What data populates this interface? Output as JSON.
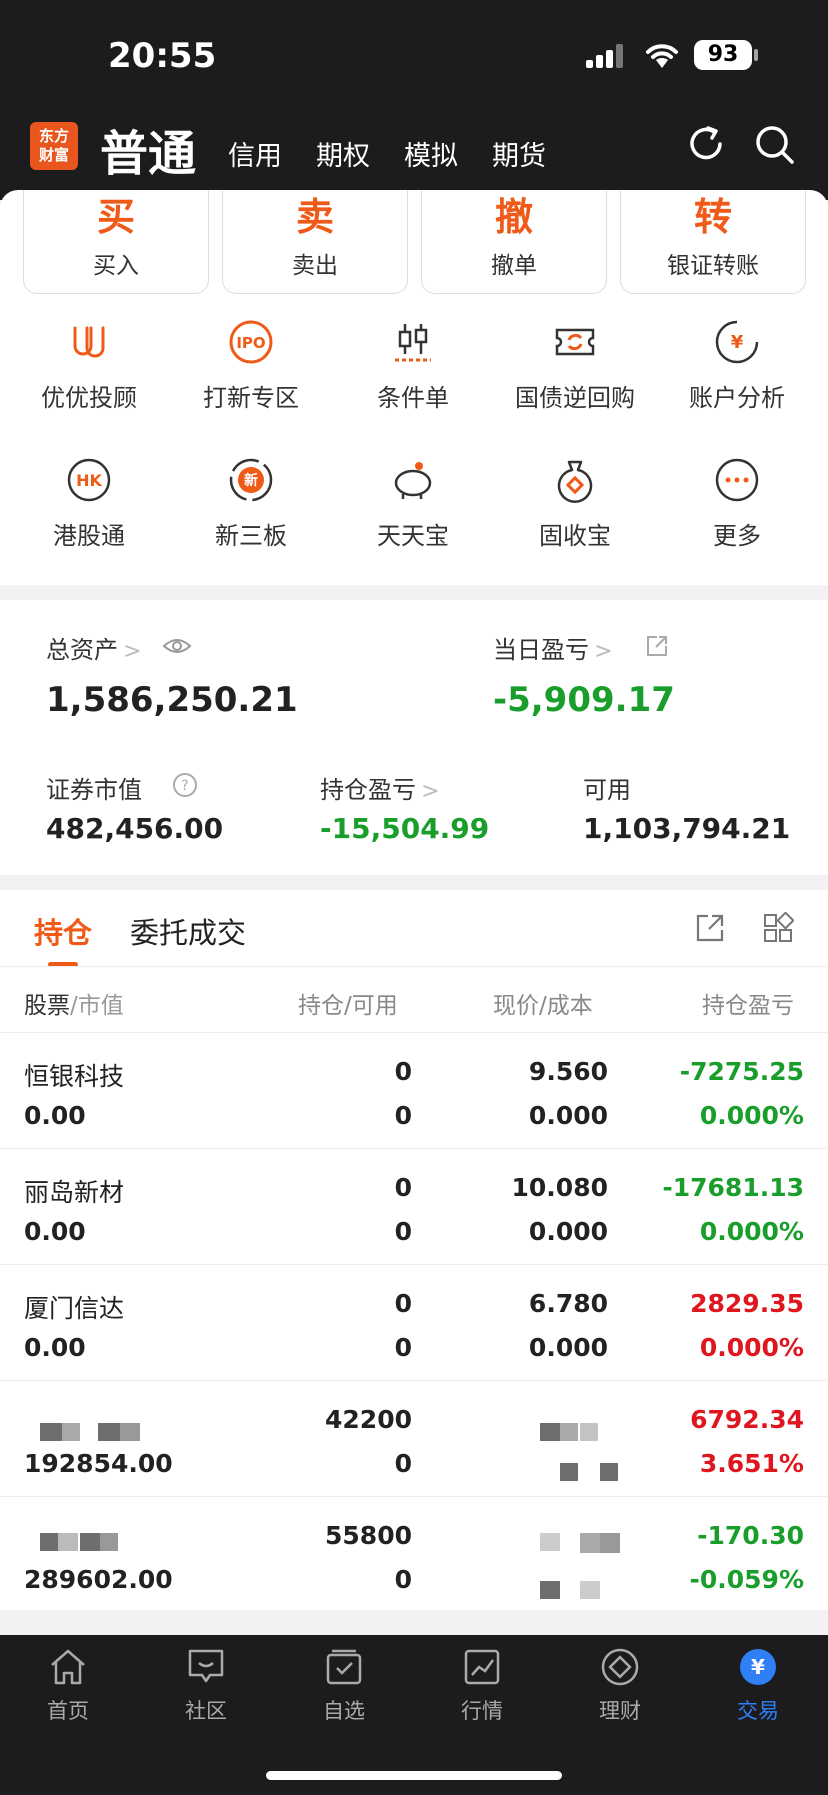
{
  "status": {
    "time": "20:55",
    "battery": "93"
  },
  "header": {
    "logo": [
      "东方",
      "财富"
    ],
    "title": "普通",
    "tabs": [
      "信用",
      "期权",
      "模拟",
      "期货"
    ]
  },
  "actions": [
    {
      "char": "买",
      "label": "买入"
    },
    {
      "char": "卖",
      "label": "卖出"
    },
    {
      "char": "撤",
      "label": "撤单"
    },
    {
      "char": "转",
      "label": "银证转账"
    }
  ],
  "shortcuts": [
    {
      "label": "优优投顾",
      "icon": "advisor-icon"
    },
    {
      "label": "打新专区",
      "icon": "ipo-icon"
    },
    {
      "label": "条件单",
      "icon": "candlestick-icon"
    },
    {
      "label": "国债逆回购",
      "icon": "repo-icon"
    },
    {
      "label": "账户分析",
      "icon": "analysis-icon"
    },
    {
      "label": "港股通",
      "icon": "hk-icon"
    },
    {
      "label": "新三板",
      "icon": "new-board-icon"
    },
    {
      "label": "天天宝",
      "icon": "piggy-bank-icon"
    },
    {
      "label": "固收宝",
      "icon": "money-bag-icon"
    },
    {
      "label": "更多",
      "icon": "more-icon"
    }
  ],
  "assets": {
    "total_label": "总资产",
    "total_value": "1,586,250.21",
    "daily_label": "当日盈亏",
    "daily_value": "-5,909.17",
    "market_label": "证券市值",
    "market_value": "482,456.00",
    "pos_pl_label": "持仓盈亏",
    "pos_pl_value": "-15,504.99",
    "available_label": "可用",
    "available_value": "1,103,794.21"
  },
  "positions": {
    "tabs": [
      "持仓",
      "委托成交"
    ],
    "headers": {
      "stock": "股票",
      "stock_sub": "/市值",
      "hold": "持仓/可用",
      "price": "现价/成本",
      "pl": "持仓盈亏"
    },
    "rows": [
      {
        "name": "恒银科技",
        "mv": "0.00",
        "hold": "0",
        "avail": "0",
        "price": "9.560",
        "cost": "0.000",
        "pl": "-7275.25",
        "pct": "0.000%",
        "pl_color": "green",
        "pct_color": "green"
      },
      {
        "name": "丽岛新材",
        "mv": "0.00",
        "hold": "0",
        "avail": "0",
        "price": "10.080",
        "cost": "0.000",
        "pl": "-17681.13",
        "pct": "0.000%",
        "pl_color": "green",
        "pct_color": "green"
      },
      {
        "name": "厦门信达",
        "mv": "0.00",
        "hold": "0",
        "avail": "0",
        "price": "6.780",
        "cost": "0.000",
        "pl": "2829.35",
        "pct": "0.000%",
        "pl_color": "red",
        "pct_color": "red"
      },
      {
        "name": "",
        "mv": "192854.00",
        "hold": "42200",
        "avail": "0",
        "price": "",
        "cost": "",
        "pl": "6792.34",
        "pct": "3.651%",
        "pl_color": "red",
        "pct_color": "red"
      },
      {
        "name": "",
        "mv": "289602.00",
        "hold": "55800",
        "avail": "0",
        "price": "",
        "cost": "",
        "pl": "-170.30",
        "pct": "-0.059%",
        "pl_color": "green",
        "pct_color": "green"
      }
    ]
  },
  "tabbar": [
    {
      "label": "首页",
      "icon": "home-icon"
    },
    {
      "label": "社区",
      "icon": "community-icon"
    },
    {
      "label": "自选",
      "icon": "watchlist-icon"
    },
    {
      "label": "行情",
      "icon": "market-chart-icon"
    },
    {
      "label": "理财",
      "icon": "wealth-icon"
    },
    {
      "label": "交易",
      "icon": "trade-yen-icon"
    }
  ],
  "colors": {
    "accent": "#f05a18",
    "green": "#1a9e2b",
    "red": "#e0161f",
    "tab_active": "#2f7ff5"
  }
}
